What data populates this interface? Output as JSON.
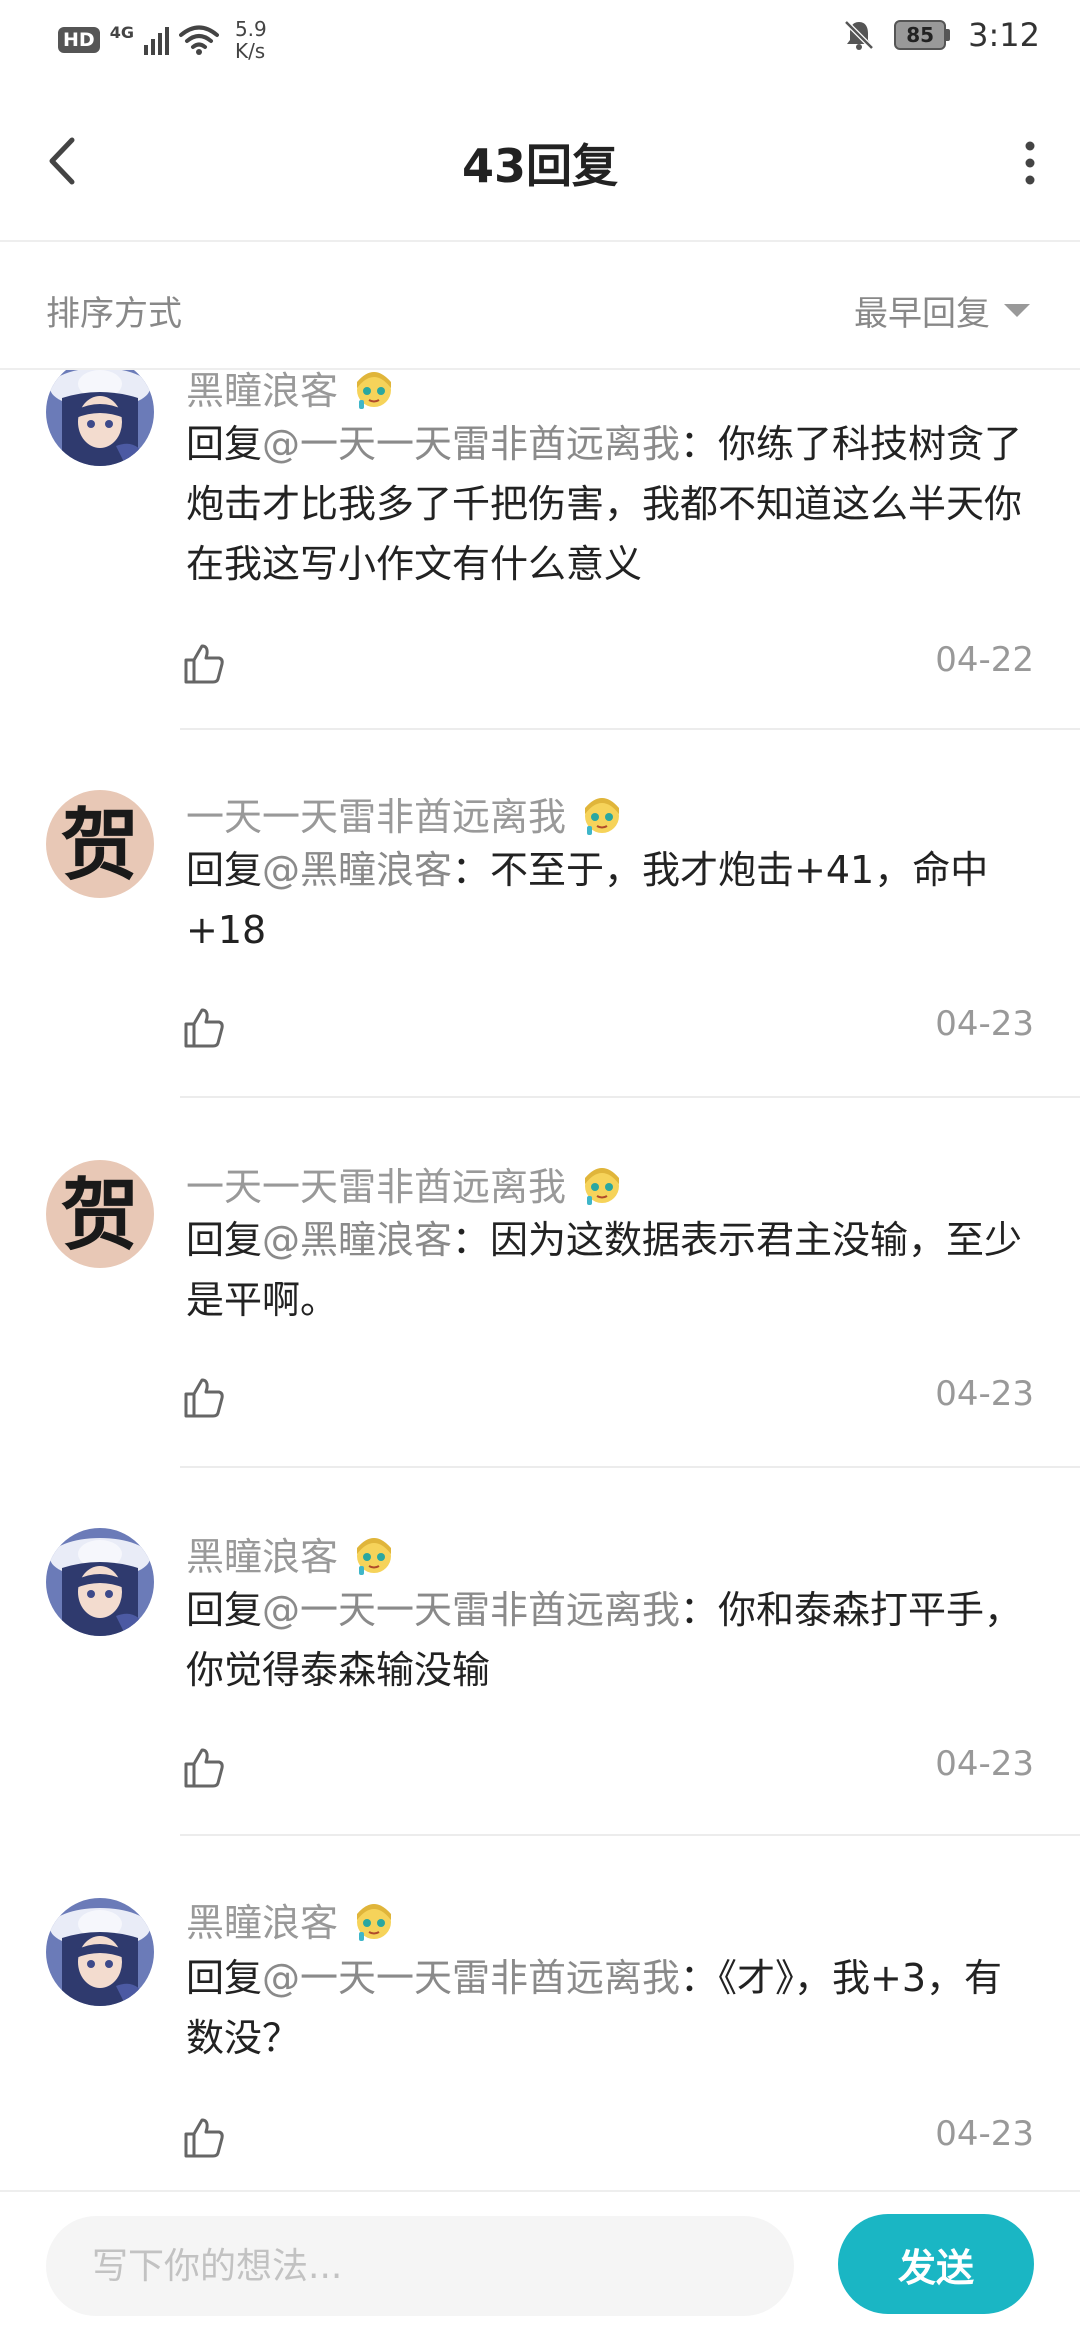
{
  "status_bar": {
    "hd": "HD",
    "network": "4G",
    "speed_value": "5.9",
    "speed_unit": "K/s",
    "battery": "85",
    "time": "3:12"
  },
  "header": {
    "title": "43回复",
    "back_icon": "chevron-left-icon",
    "more_icon": "vertical-dots-icon"
  },
  "sort": {
    "label": "排序方式",
    "selected": "最早回复"
  },
  "replies": [
    {
      "username": "黑瞳浪客",
      "avatar": "anime-girl-avatar",
      "prefix": "回复",
      "mention": "@一天一天雷非酋远离我",
      "text": "：你练了科技树贪了炮击才比我多了千把伤害，我都不知道这么半天你在我这写小作文有什么意义",
      "date": "04-22"
    },
    {
      "username": "一天一天雷非酋远离我",
      "avatar": "calligraphy-avatar",
      "avatar_char": "贺",
      "prefix": "回复",
      "mention": "@黑瞳浪客",
      "text": "：不至于，我才炮击+41，命中+18",
      "date": "04-23"
    },
    {
      "username": "一天一天雷非酋远离我",
      "avatar": "calligraphy-avatar",
      "avatar_char": "贺",
      "prefix": "回复",
      "mention": "@黑瞳浪客",
      "text": "：因为这数据表示君主没输，至少是平啊。",
      "date": "04-23"
    },
    {
      "username": "黑瞳浪客",
      "avatar": "anime-girl-avatar",
      "prefix": "回复",
      "mention": "@一天一天雷非酋远离我",
      "text": "：你和泰森打平手，你觉得泰森输没输",
      "date": "04-23"
    },
    {
      "username": "黑瞳浪客",
      "avatar": "anime-girl-avatar",
      "prefix": "回复",
      "mention": "@一天一天雷非酋远离我",
      "text": "：《才》，我+3，有数没？",
      "date": "04-23"
    }
  ],
  "composer": {
    "placeholder": "写下你的想法...",
    "send_label": "发送"
  },
  "colors": {
    "accent": "#1ab6c4",
    "mention": "#8a8a8a",
    "muted": "#999999"
  }
}
